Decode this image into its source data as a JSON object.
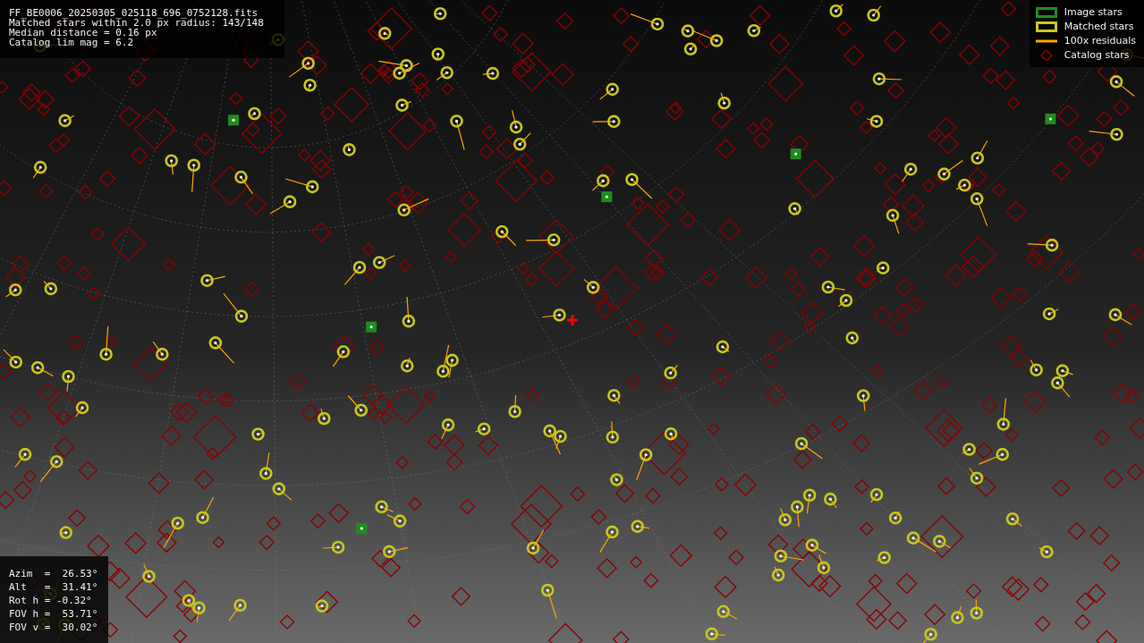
{
  "info_lines": [
    "FF_BE0006_20250305_025118_696_0752128.fits",
    "Matched stars within 2.0 px radius: 143/148",
    "Median distance = 0.16 px",
    "Catalog lim mag = 6.2"
  ],
  "legend": [
    {
      "label": "Image stars",
      "kind": "image",
      "color": "#1e8c1e"
    },
    {
      "label": "Matched stars",
      "kind": "matched",
      "color": "#c8c81e"
    },
    {
      "label": "100x residuals",
      "kind": "residual",
      "color": "#ffa500"
    },
    {
      "label": "Catalog stars",
      "kind": "catalog",
      "color": "#8b0000"
    }
  ],
  "pointing_lines": [
    "Azim  =  26.53°",
    "Alt   =  31.41°",
    "Rot h = -0.32°",
    "FOV h =  53.71°",
    "FOV v =  30.02°"
  ]
}
